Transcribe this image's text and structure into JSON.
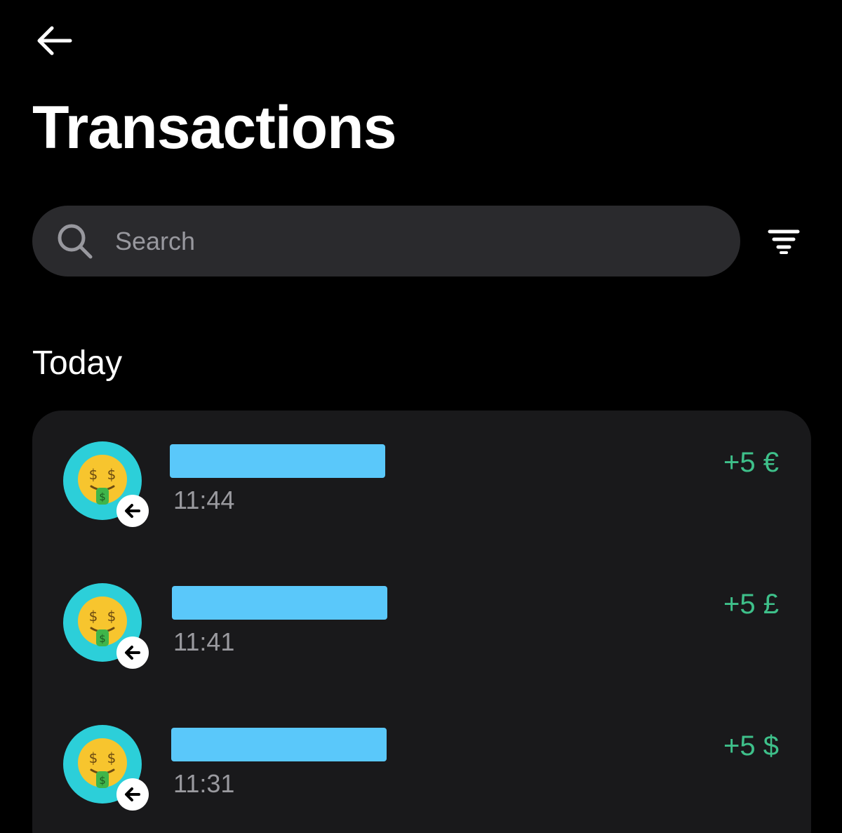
{
  "header": {
    "back_icon": "arrow-left-icon",
    "title": "Transactions"
  },
  "search": {
    "icon": "search-icon",
    "placeholder": "Search",
    "value": ""
  },
  "filter": {
    "icon": "filter-icon"
  },
  "sections": [
    {
      "label": "Today",
      "transactions": [
        {
          "avatar_icon": "money-mouth-face-icon",
          "direction_icon": "incoming-arrow-icon",
          "name_redacted": true,
          "time": "11:44",
          "amount": "+5 €"
        },
        {
          "avatar_icon": "money-mouth-face-icon",
          "direction_icon": "incoming-arrow-icon",
          "name_redacted": true,
          "time": "11:41",
          "amount": "+5 £"
        },
        {
          "avatar_icon": "money-mouth-face-icon",
          "direction_icon": "incoming-arrow-icon",
          "name_redacted": true,
          "time": "11:31",
          "amount": "+5 $"
        }
      ]
    }
  ],
  "colors": {
    "background": "#000000",
    "search_background": "#2a2a2d",
    "card_background": "#19191b",
    "avatar_background": "#2ccfd9",
    "redaction": "#5ac8fa",
    "positive_amount": "#3ec08a",
    "secondary_text": "#9a9a9f"
  }
}
